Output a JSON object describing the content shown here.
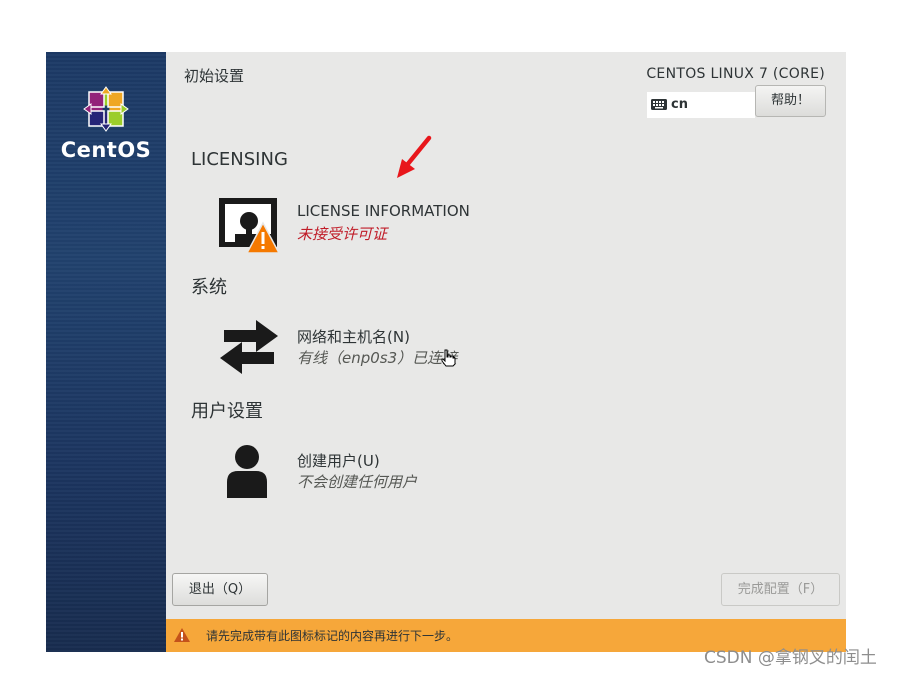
{
  "sidebar": {
    "logo_text": "CentOS",
    "logo_icon": "centos-logo-icon"
  },
  "header": {
    "title": "初始设置",
    "product": "CENTOS LINUX 7 (CORE)"
  },
  "keyboard": {
    "layout": "cn",
    "icon": "keyboard-icon"
  },
  "help_button": {
    "label": "帮助！"
  },
  "sections": {
    "licensing": {
      "heading": "LICENSING",
      "spoke": {
        "title": "LICENSE INFORMATION",
        "status": "未接受许可证",
        "icon": "license-warning-icon"
      }
    },
    "system": {
      "heading": "系统",
      "spoke": {
        "title": "网络和主机名(N)",
        "status": "有线（enp0s3）已连接",
        "icon": "network-arrows-icon"
      }
    },
    "user": {
      "heading": "用户设置",
      "spoke": {
        "title": "创建用户(U)",
        "status": "不会创建任何用户",
        "icon": "user-icon"
      }
    }
  },
  "footer": {
    "quit_label": "退出（Q）",
    "finish_label": "完成配置（F）"
  },
  "warning_bar": {
    "text": "请先完成带有此图标标记的内容再进行下一步。",
    "icon": "warning-icon",
    "color": "#f6a73a"
  },
  "watermark": "CSDN @拿钢叉的闰土",
  "colors": {
    "error": "#c01c28",
    "annotation_arrow": "#e8161b",
    "sidebar": "#1d3a66"
  }
}
